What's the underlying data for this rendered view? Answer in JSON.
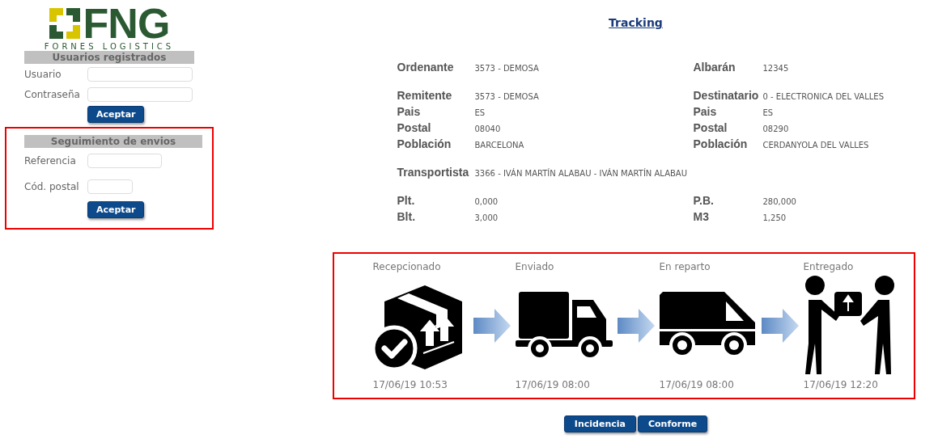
{
  "logo": {
    "title": "FNG",
    "subtitle": "FORNES LOGISTICS"
  },
  "login": {
    "heading": "Usuarios registrados",
    "fields": [
      {
        "label": "Usuario"
      },
      {
        "label": "Contraseña"
      }
    ],
    "button": "Aceptar"
  },
  "tracking_form": {
    "heading": "Seguimiento de envios",
    "fields": [
      {
        "label": "Referencia"
      },
      {
        "label": "Cód. postal"
      }
    ],
    "button": "Aceptar"
  },
  "page_title": "Tracking",
  "info_groups": [
    [
      {
        "label": "Ordenante",
        "value": "3573 - DEMOSA",
        "label_2": "Albarán",
        "value_2": "12345"
      }
    ],
    [
      {
        "label": "Remitente",
        "value": "3573 - DEMOSA",
        "label_2": "Destinatario",
        "value_2": "0 - ELECTRONICA DEL VALLES"
      },
      {
        "label": "Pais",
        "value": "ES",
        "label_2": "Pais",
        "value_2": "ES"
      },
      {
        "label": "Postal",
        "value": "08040",
        "label_2": "Postal",
        "value_2": "08290"
      },
      {
        "label": "Población",
        "value": "BARCELONA",
        "label_2": "Población",
        "value_2": "CERDANYOLA DEL VALLES"
      }
    ],
    [
      {
        "label": "Transportista",
        "value": "3366 - IVÁN MARTÍN ALABAU - IVÁN MARTÍN ALABAU"
      }
    ],
    [
      {
        "label": "Plt.",
        "value": "0,000",
        "label_2": "P.B.",
        "value_2": "280,000"
      },
      {
        "label": "Blt.",
        "value": "3,000",
        "label_2": "M3",
        "value_2": "1,250"
      }
    ]
  ],
  "stages": [
    {
      "kind": "received",
      "label": "Recepcionado",
      "time": "17/06/19 10:53"
    },
    {
      "kind": "sent",
      "label": "Enviado",
      "time": "17/06/19 08:00"
    },
    {
      "kind": "delivery",
      "label": "En reparto",
      "time": "17/06/19 08:00"
    },
    {
      "kind": "delivered",
      "label": "Entregado",
      "time": "17/06/19 12:20"
    }
  ],
  "buttons": [
    "Incidencia",
    "Conforme"
  ]
}
